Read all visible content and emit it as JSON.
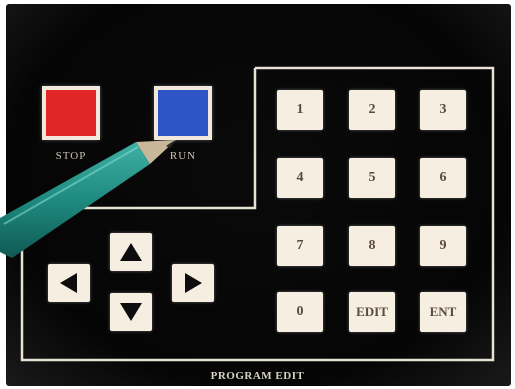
{
  "panel": {
    "stop_label": "STOP",
    "run_label": "RUN",
    "bottom_label": "PROGRAM EDIT"
  },
  "keypad": {
    "keys": [
      "1",
      "2",
      "3",
      "4",
      "5",
      "6",
      "7",
      "8",
      "9",
      "0",
      "EDIT",
      "ENT"
    ]
  },
  "arrows": {
    "up": "arrow-up-icon",
    "down": "arrow-down-icon",
    "left": "arrow-left-icon",
    "right": "arrow-right-icon"
  },
  "colors": {
    "stop": "#e02626",
    "run": "#2d55c8",
    "key_face": "#f6efe1",
    "panel_bg": "#050505",
    "outline": "#e8e2d6"
  }
}
